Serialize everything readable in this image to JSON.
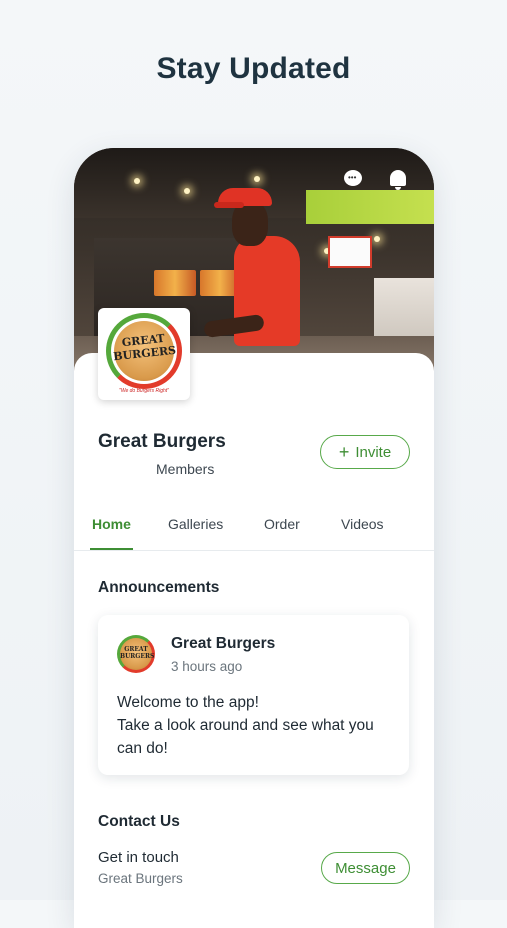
{
  "headline": "Stay Updated",
  "cover": {
    "chat_icon": "chat-bubble-icon",
    "bell_icon": "bell-icon"
  },
  "logo": {
    "line1": "GREAT",
    "line2": "BURGERS",
    "tagline": "\"We do Burgers Right\""
  },
  "group": {
    "name": "Great Burgers",
    "members_label": "Members",
    "invite_label": "Invite",
    "invite_icon": "plus-icon"
  },
  "tabs": [
    {
      "label": "Home",
      "active": true
    },
    {
      "label": "Galleries",
      "active": false
    },
    {
      "label": "Order",
      "active": false
    },
    {
      "label": "Videos",
      "active": false
    }
  ],
  "announcements": {
    "title": "Announcements",
    "post": {
      "author": "Great Burgers",
      "time": "3 hours ago",
      "line1": "Welcome to the app!",
      "line2": "Take a look around and see what you can do!"
    }
  },
  "contact": {
    "title": "Contact Us",
    "line1": "Get in touch",
    "line2": "Great Burgers",
    "message_label": "Message"
  },
  "colors": {
    "accent": "#3e8e34",
    "brand_red": "#e53a27"
  }
}
